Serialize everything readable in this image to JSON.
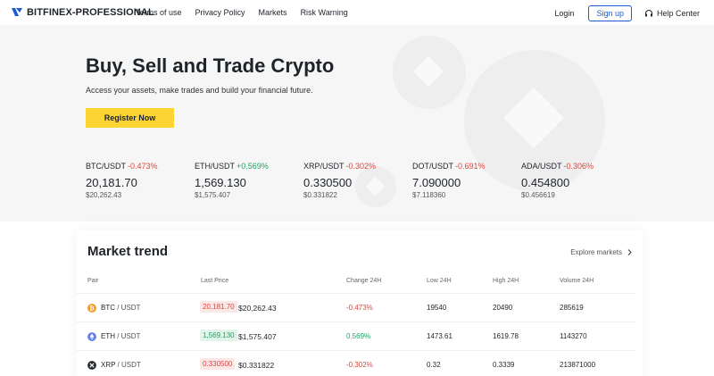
{
  "nav": {
    "logo": "BITFINEX-PROFESSIONAL",
    "links": [
      "Terms of use",
      "Privacy Policy",
      "Markets",
      "Risk Warning"
    ],
    "login": "Login",
    "signup": "Sign up",
    "help": "Help Center"
  },
  "hero": {
    "title": "Buy, Sell and Trade Crypto",
    "subtitle": "Access your assets, make trades and build your financial future.",
    "cta": "Register Now"
  },
  "tickers": [
    {
      "pair": "BTC/USDT",
      "change": "-0.473%",
      "price": "20,181.70",
      "usd": "$20,262.43",
      "dir": "red"
    },
    {
      "pair": "ETH/USDT",
      "change": "+0.569%",
      "price": "1,569.130",
      "usd": "$1,575.407",
      "dir": "green"
    },
    {
      "pair": "XRP/USDT",
      "change": "-0.302%",
      "price": "0.330500",
      "usd": "$0.331822",
      "dir": "red"
    },
    {
      "pair": "DOT/USDT",
      "change": "-0.691%",
      "price": "7.090000",
      "usd": "$7.118360",
      "dir": "red"
    },
    {
      "pair": "ADA/USDT",
      "change": "-0.306%",
      "price": "0.454800",
      "usd": "$0.456619",
      "dir": "red"
    }
  ],
  "market": {
    "title": "Market trend",
    "explore": "Explore markets",
    "headers": [
      "Pair",
      "Last Price",
      "Change 24H",
      "Low 24H",
      "High 24H",
      "Volume 24H"
    ],
    "rows": [
      {
        "base": "BTC",
        "quote": " / USDT",
        "last": "20,181.70",
        "usd": "$20,262.43",
        "change": "-0.473%",
        "low": "19540",
        "high": "20490",
        "volume": "285619",
        "dir": "red",
        "icon": "bitcoin-icon",
        "color": "#f7931a"
      },
      {
        "base": "ETH",
        "quote": " / USDT",
        "last": "1,569.130",
        "usd": "$1,575.407",
        "change": "0.569%",
        "low": "1473.61",
        "high": "1619.78",
        "volume": "1143270",
        "dir": "green",
        "icon": "ethereum-icon",
        "color": "#627eea"
      },
      {
        "base": "XRP",
        "quote": " / USDT",
        "last": "0.330500",
        "usd": "$0.331822",
        "change": "-0.302%",
        "low": "0.32",
        "high": "0.3339",
        "volume": "213871000",
        "dir": "red",
        "icon": "xrp-icon",
        "color": "#23292f"
      }
    ]
  },
  "colors": {
    "accent": "#fcd535",
    "link": "#1c5bd4",
    "down": "#e0453f",
    "up": "#1ca560"
  }
}
